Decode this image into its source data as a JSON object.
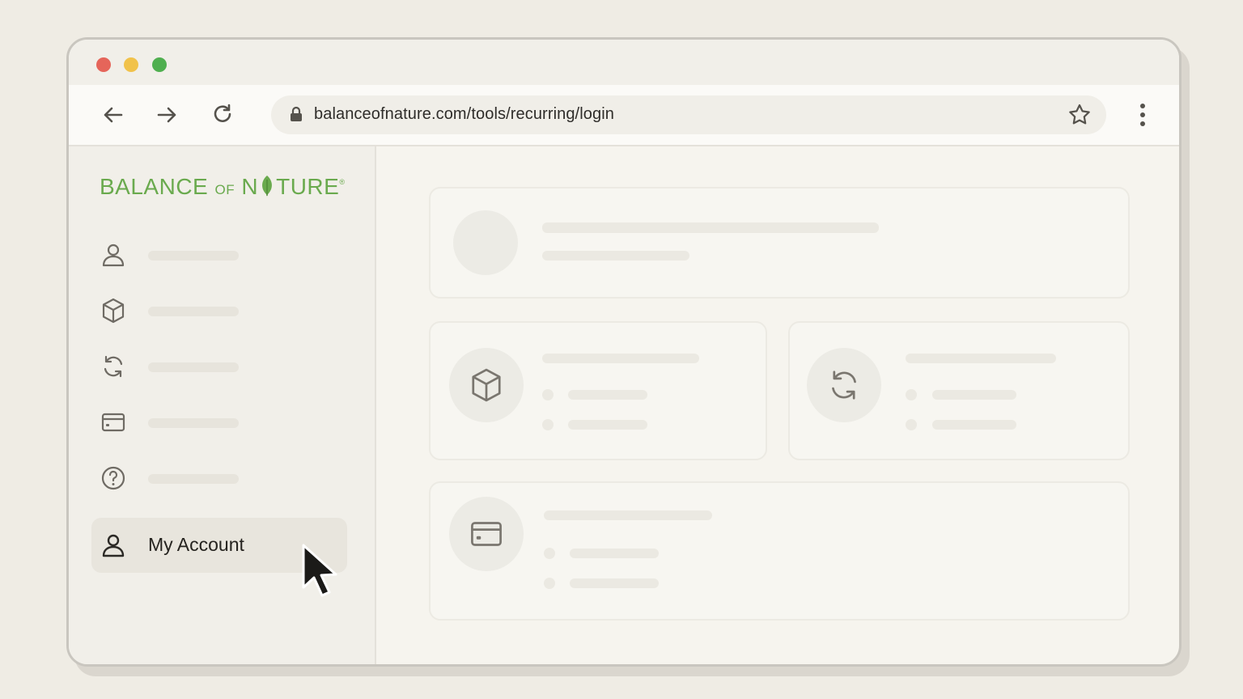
{
  "browser": {
    "url": "balanceofnature.com/tools/recurring/login"
  },
  "logo": {
    "part1": "BALANCE ",
    "part2": "OF",
    "part3": " N",
    "part4": "TURE",
    "mark": "®"
  },
  "sidebar": {
    "items": [
      {
        "icon": "user-icon"
      },
      {
        "icon": "box-icon"
      },
      {
        "icon": "refresh-icon"
      },
      {
        "icon": "credit-card-icon"
      },
      {
        "icon": "help-icon"
      }
    ],
    "account_label": "My Account"
  },
  "colors": {
    "brand_green": "#6aaa4e",
    "close_dot": "#e5655a",
    "minimize_dot": "#f1c24b",
    "maximize_dot": "#4faf4f"
  }
}
